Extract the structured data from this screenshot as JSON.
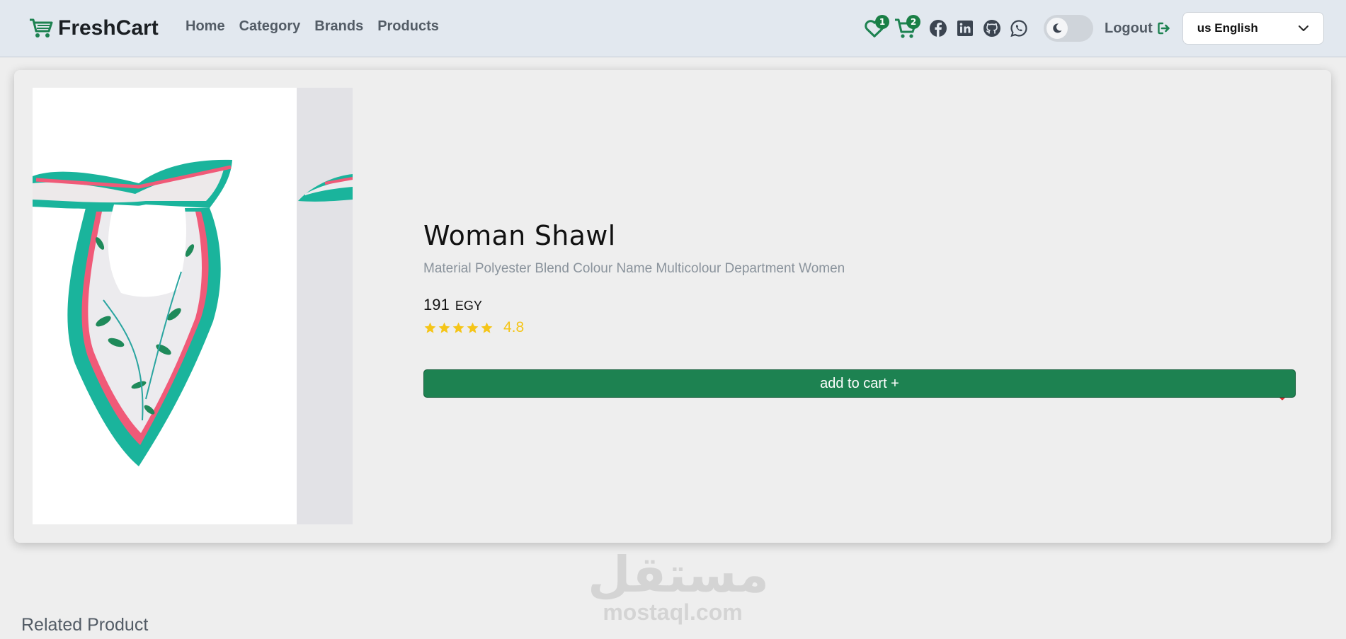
{
  "navbar": {
    "brand": "FreshCart",
    "links": [
      "Home",
      "Category",
      "Brands",
      "Products"
    ],
    "wishlist_count": "1",
    "cart_count": "2",
    "social_icons": [
      "facebook-icon",
      "linkedin-icon",
      "github-icon",
      "whatsapp-icon"
    ],
    "logout_label": "Logout",
    "language": "us English"
  },
  "product": {
    "title": "Woman Shawl",
    "description": "Material Polyester Blend Colour Name Multicolour Department Women",
    "price": "191",
    "currency": "EGY",
    "rating": "4.8",
    "stars": 5,
    "add_to_cart_label": "add to cart +"
  },
  "watermark": {
    "arabic": "مستقل",
    "latin": "mostaql.com"
  },
  "related": {
    "title": "Related Product"
  },
  "colors": {
    "brand_green": "#1d8251",
    "navbar_bg": "#e2e8ef",
    "star_yellow": "#f5c518",
    "heart_red": "#d32f2f"
  }
}
